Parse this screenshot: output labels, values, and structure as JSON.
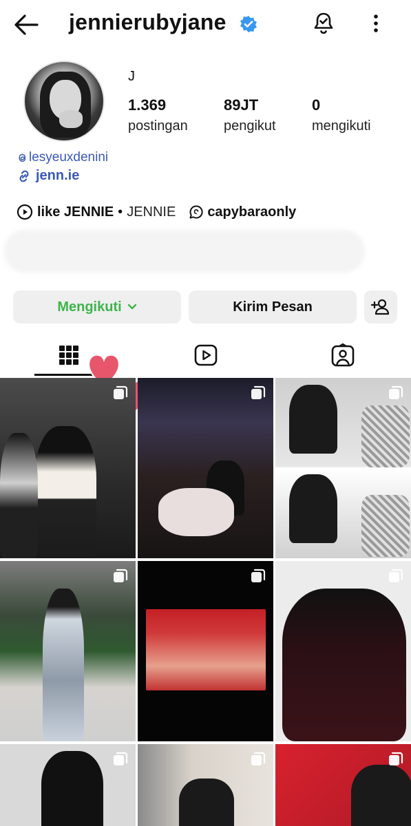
{
  "header": {
    "username": "jennierubyjane",
    "back_icon": "arrow-left-icon",
    "verified_icon": "verified-badge-icon",
    "verified_color": "#3897f0",
    "bell_icon": "bell-check-icon",
    "more_icon": "more-vertical-icon"
  },
  "profile": {
    "display_name": "J",
    "stats": [
      {
        "value": "1.369",
        "label": "postingan"
      },
      {
        "value": "89JT",
        "label": "pengikut"
      },
      {
        "value": "0",
        "label": "mengikuti"
      }
    ],
    "threads_handle": "lesyeuxdenini",
    "website": "jenn.ie",
    "music": {
      "song": "like JENNIE",
      "separator": "•",
      "artist": "JENNIE"
    },
    "threads_badge": "capybaraonly",
    "link_color": "#3a59b5"
  },
  "actions": {
    "follow_label": "Mengikuti",
    "follow_color": "#3db54a",
    "message_label": "Kirim Pesan",
    "add_user_icon": "add-user-icon"
  },
  "tabs": [
    {
      "name": "grid",
      "icon": "grid-icon",
      "active": true
    },
    {
      "name": "reels",
      "icon": "reels-icon",
      "active": false
    },
    {
      "name": "tagged",
      "icon": "tagged-user-icon",
      "active": false
    }
  ],
  "sticker_color": "#e8566c",
  "posts": [
    {
      "multi": true,
      "tone": "#3a3a3a"
    },
    {
      "multi": true,
      "tone": "#2d2a2a"
    },
    {
      "multi": true,
      "tone": "#bdbdbd"
    },
    {
      "multi": true,
      "tone": "#6c7b6a"
    },
    {
      "multi": true,
      "tone": "#0a0a0a"
    },
    {
      "multi": true,
      "tone": "#e8e8e8"
    },
    {
      "multi": true,
      "tone": "#d8d8d8"
    },
    {
      "multi": true,
      "tone": "#cfc8bf"
    },
    {
      "multi": true,
      "tone": "#c21f2b"
    }
  ]
}
